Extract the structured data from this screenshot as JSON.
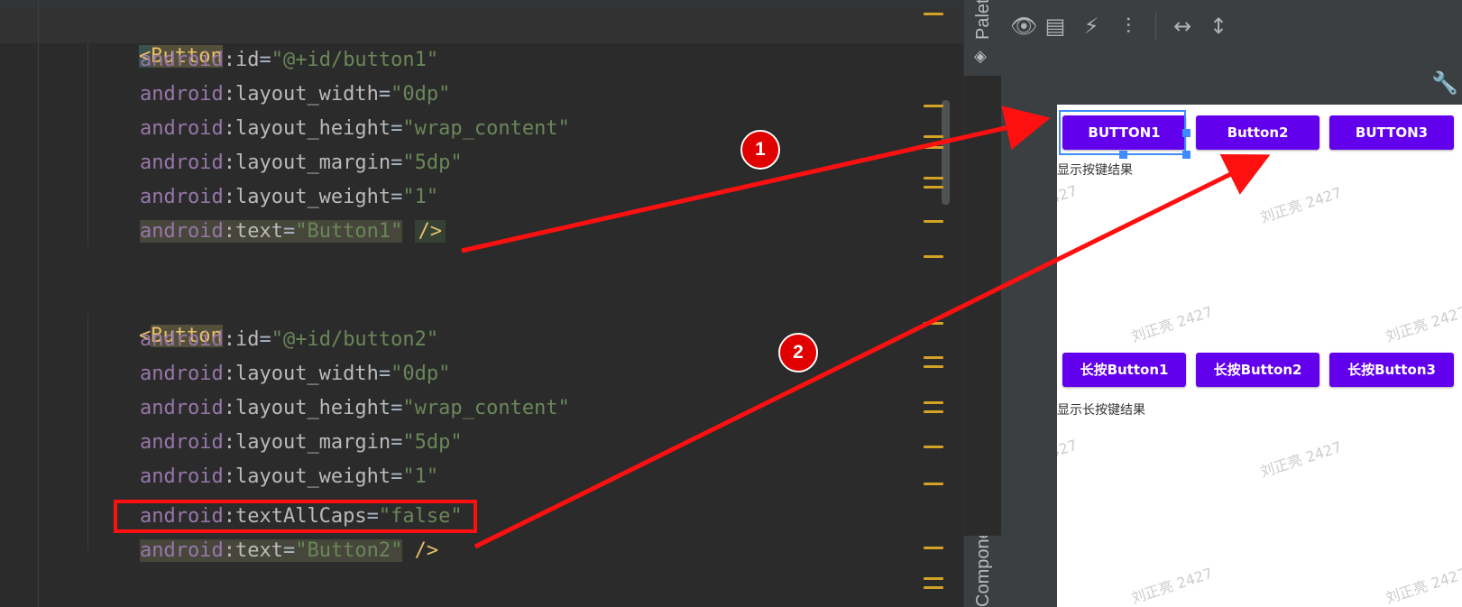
{
  "editor": {
    "lines": [
      {
        "kind": "open",
        "tag": "Button"
      },
      {
        "ns": "android",
        "attr": "id",
        "val": "\"@+id/button1\""
      },
      {
        "ns": "android",
        "attr": "layout_width",
        "val": "\"0dp\""
      },
      {
        "ns": "android",
        "attr": "layout_height",
        "val": "\"wrap_content\""
      },
      {
        "ns": "android",
        "attr": "layout_margin",
        "val": "\"5dp\""
      },
      {
        "ns": "android",
        "attr": "layout_weight",
        "val": "\"1\""
      },
      {
        "ns": "android",
        "attr": "text",
        "val": "\"Button1\"",
        "close": "/>"
      },
      {
        "kind": "open",
        "tag": "Button"
      },
      {
        "ns": "android",
        "attr": "id",
        "val": "\"@+id/button2\""
      },
      {
        "ns": "android",
        "attr": "layout_width",
        "val": "\"0dp\""
      },
      {
        "ns": "android",
        "attr": "layout_height",
        "val": "\"wrap_content\""
      },
      {
        "ns": "android",
        "attr": "layout_margin",
        "val": "\"5dp\""
      },
      {
        "ns": "android",
        "attr": "layout_weight",
        "val": "\"1\""
      },
      {
        "ns": "android",
        "attr": "textAllCaps",
        "val": "\"false\""
      },
      {
        "ns": "android",
        "attr": "text",
        "val": "\"Button2\"",
        "close": "/>"
      }
    ],
    "open_bracket": "<",
    "colon": ":",
    "equals": "="
  },
  "side_tabs": {
    "palette": "Palette",
    "component_tree": "Component Tree"
  },
  "toolbar": {
    "icons": [
      "eye-icon",
      "blueprint-icon",
      "magnet-off-icon",
      "clear-constraints-icon",
      "expand-horizontal-icon",
      "expand-vertical-icon"
    ],
    "glyphs": [
      "👁",
      "▤",
      "⚡",
      "⫶",
      "↔",
      "↕"
    ]
  },
  "wrench_glyph": "🔧",
  "device": {
    "row1_buttons": [
      "BUTTON1",
      "Button2",
      "BUTTON3"
    ],
    "result_label": "显示按键结果",
    "row2_buttons": [
      "长按Button1",
      "长按Button2",
      "长按Button3"
    ],
    "long_result_label": "显示长按键结果",
    "watermark": "刘正亮 2427",
    "watermark_partial": "427"
  },
  "annotations": {
    "badge1": "1",
    "badge2": "2",
    "arrow_color": "#ff1010",
    "badge_color": "#e00000"
  },
  "colors": {
    "editor_bg": "#2b2b2b",
    "button_purple": "#6200ee",
    "selection_blue": "#3d8bff"
  }
}
